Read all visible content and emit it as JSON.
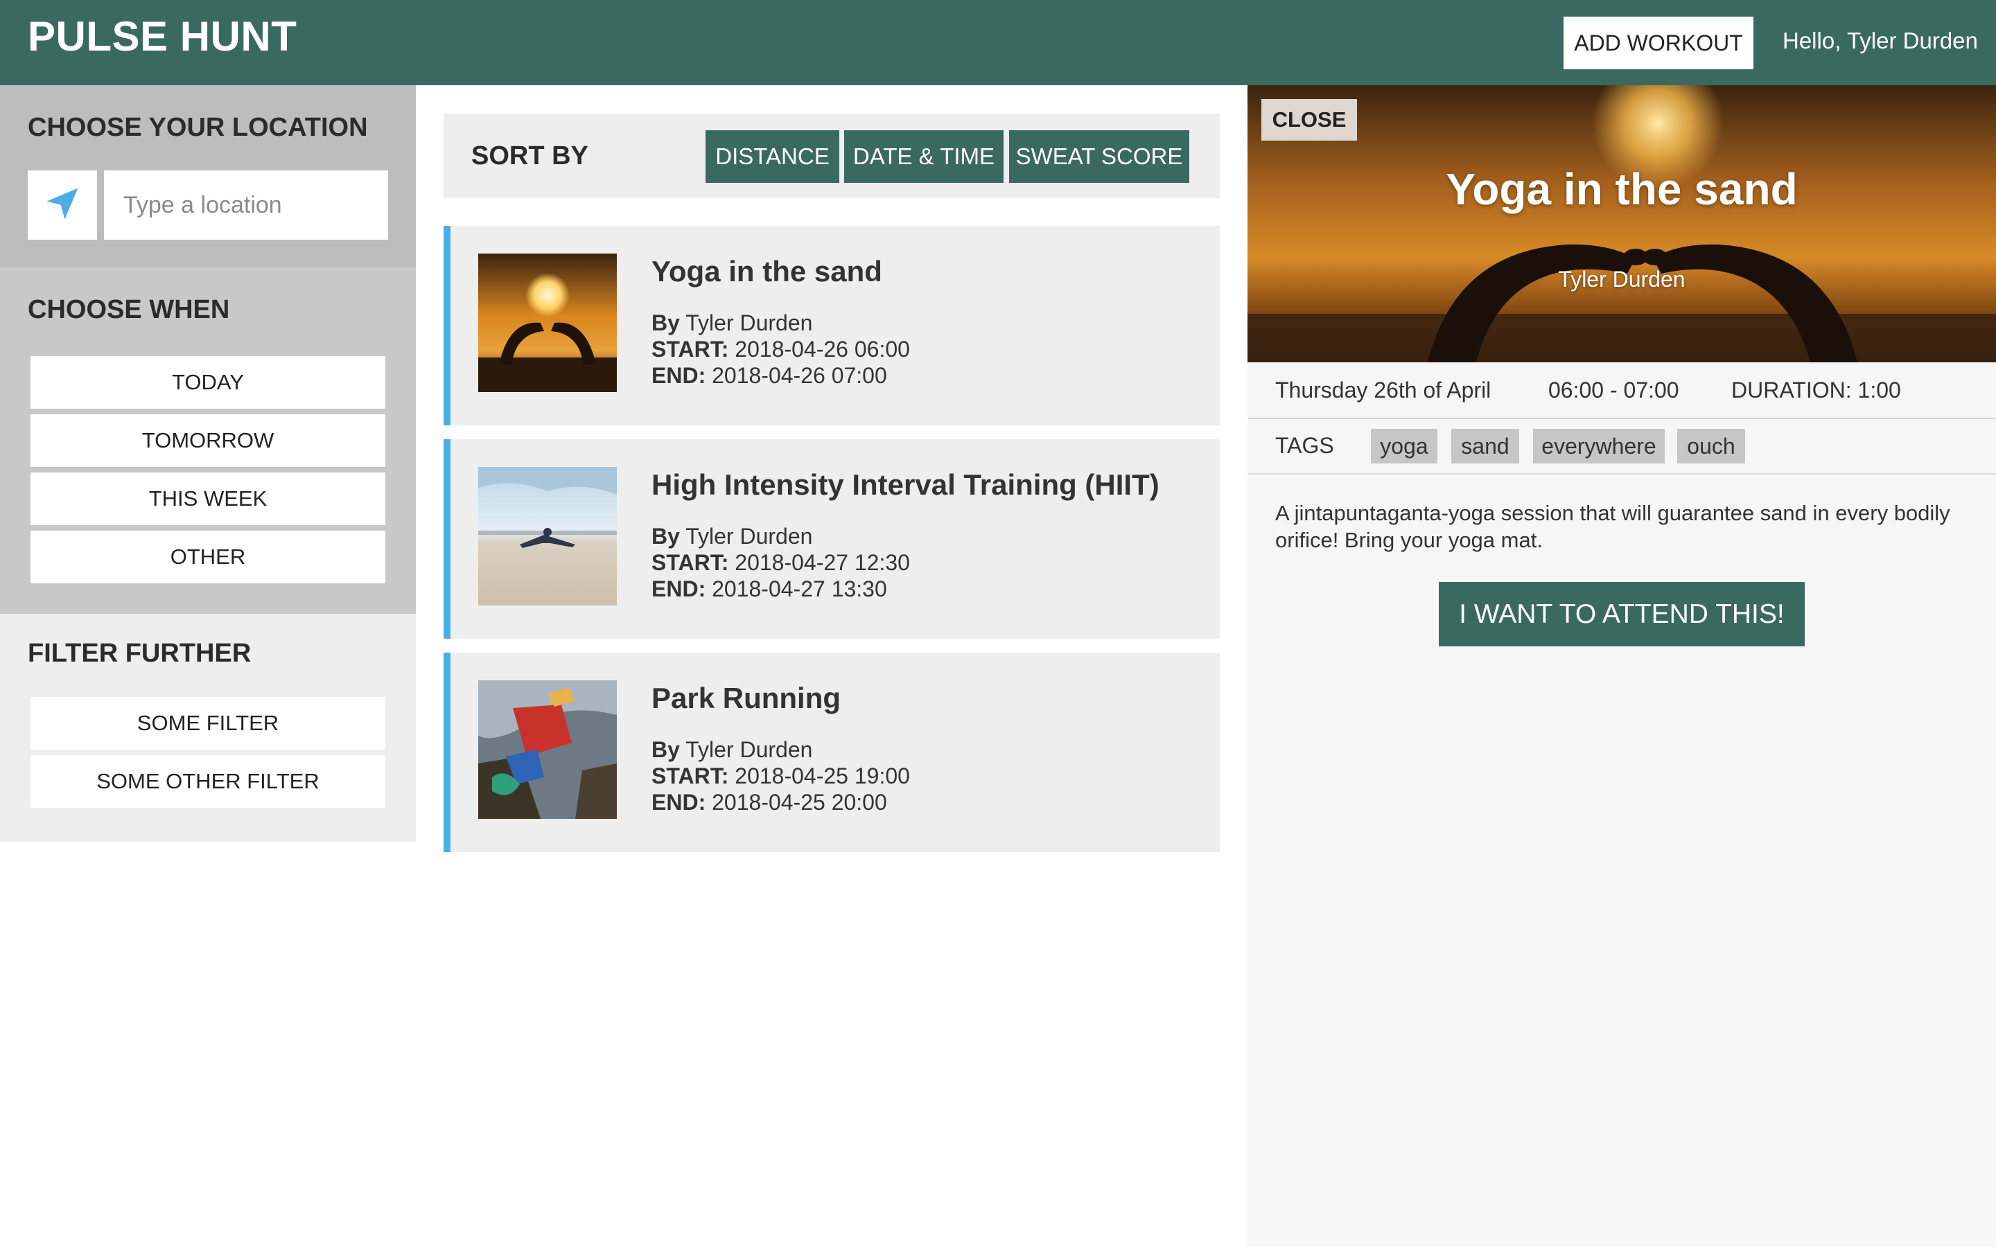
{
  "header": {
    "brand": "PULSE HUNT",
    "add_workout_label": "ADD WORKOUT",
    "greeting": "Hello, Tyler Durden",
    "bar_color": "#3a6a5f"
  },
  "sidebar": {
    "location": {
      "title": "CHOOSE YOUR LOCATION",
      "locate_icon": "navigation-arrow-icon",
      "placeholder": "Type a location"
    },
    "when": {
      "title": "CHOOSE WHEN",
      "options": [
        "TODAY",
        "TOMORROW",
        "THIS WEEK",
        "OTHER"
      ]
    },
    "filter": {
      "title": "FILTER FURTHER",
      "options": [
        "SOME FILTER",
        "SOME OTHER FILTER"
      ]
    }
  },
  "sort": {
    "label": "SORT BY",
    "options": [
      "DISTANCE",
      "DATE & TIME",
      "SWEAT SCORE"
    ]
  },
  "workouts": [
    {
      "title": "Yoga in the sand",
      "by_label": "By",
      "author": "Tyler Durden",
      "start_label": "START:",
      "start": "2018-04-26 06:00",
      "end_label": "END:",
      "end": "2018-04-26 07:00"
    },
    {
      "title": "High Intensity Interval Training (HIIT)",
      "by_label": "By",
      "author": "Tyler Durden",
      "start_label": "START:",
      "start": "2018-04-27 12:30",
      "end_label": "END:",
      "end": "2018-04-27 13:30"
    },
    {
      "title": "Park Running",
      "by_label": "By",
      "author": "Tyler Durden",
      "start_label": "START:",
      "start": "2018-04-25 19:00",
      "end_label": "END:",
      "end": "2018-04-25 20:00"
    }
  ],
  "detail": {
    "close_label": "CLOSE",
    "title": "Yoga in the sand",
    "author": "Tyler Durden",
    "date": "Thursday 26th of April",
    "time": "06:00 - 07:00",
    "duration": "DURATION: 1:00",
    "tags_label": "TAGS",
    "tags": [
      "yoga",
      "sand",
      "everywhere",
      "ouch"
    ],
    "description": "A jintapuntaganta-yoga session that will guarantee sand in every bodily orifice! Bring your yoga mat.",
    "attend_label": "I WANT TO ATTEND THIS!"
  },
  "colors": {
    "accent": "#3a6a5f",
    "card_border": "#4aaee6",
    "location_icon": "#4aaee6"
  }
}
